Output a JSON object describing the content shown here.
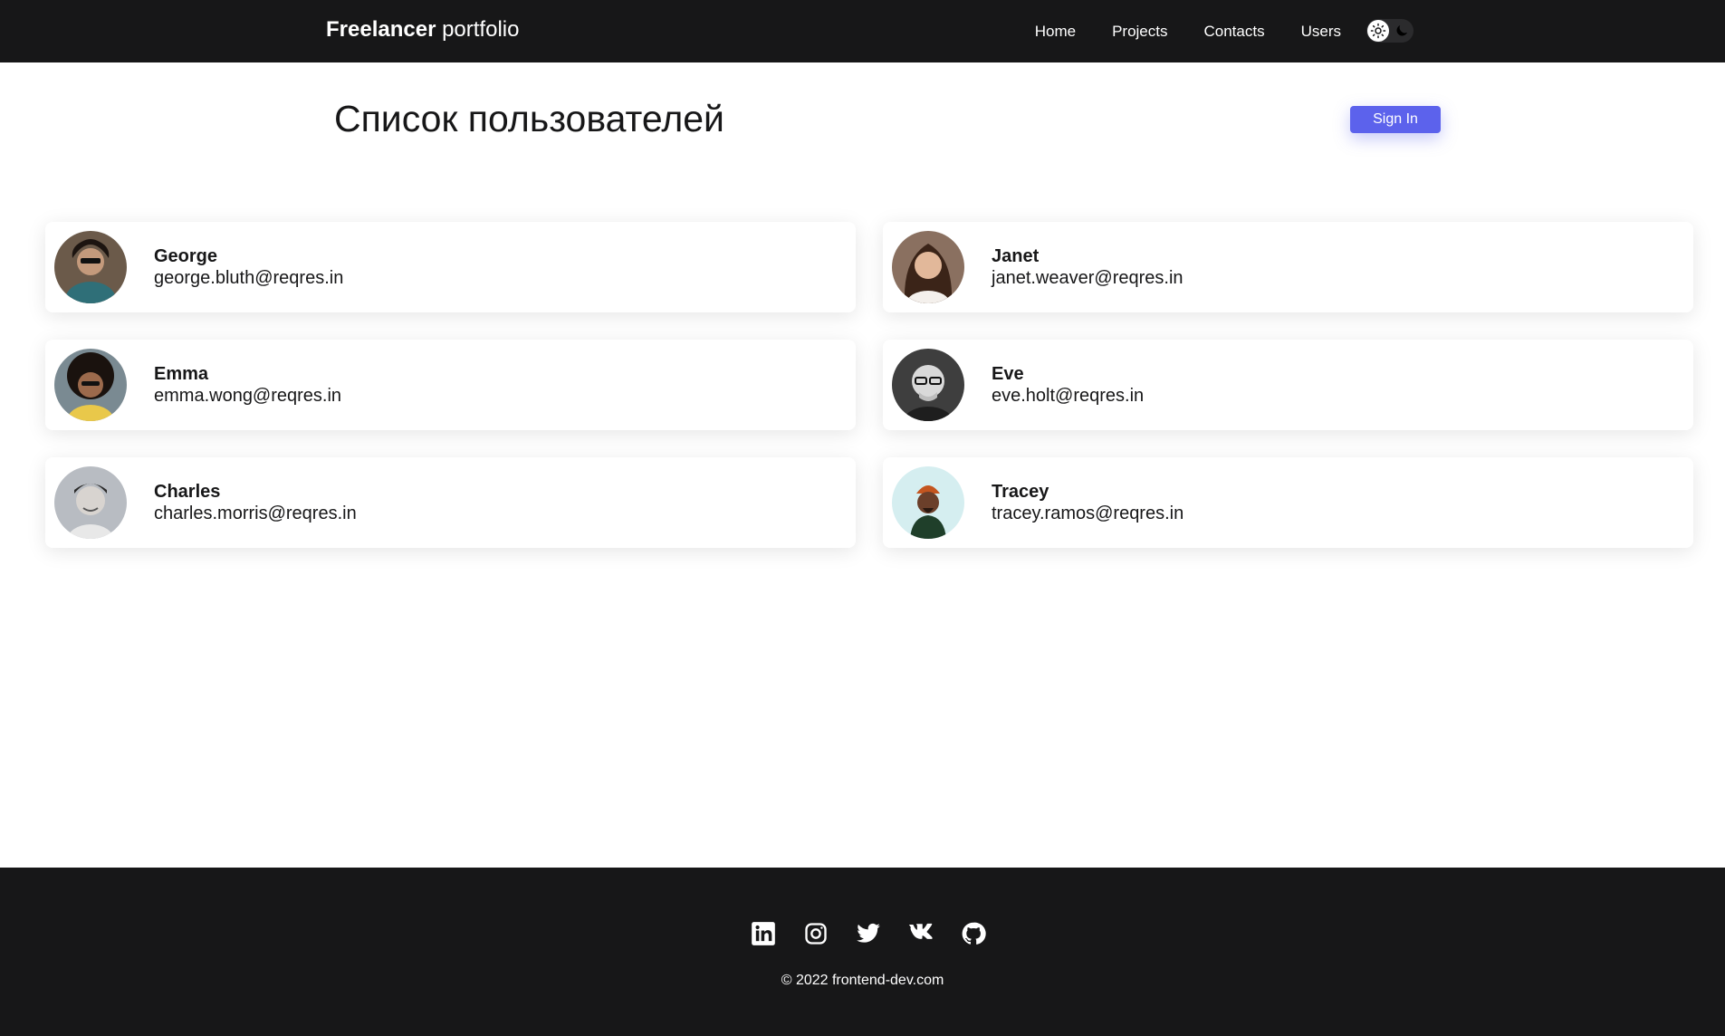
{
  "navbar": {
    "brand_bold": "Freelancer",
    "brand_rest": "portfolio",
    "links": [
      "Home",
      "Projects",
      "Contacts",
      "Users"
    ],
    "theme_icons": [
      "sun-icon",
      "moon-icon"
    ]
  },
  "header": {
    "title": "Список пользователей",
    "signin_label": "Sign In"
  },
  "users": [
    {
      "name": "George",
      "email": "george.bluth@reqres.in",
      "avatar_bg": "#6b5a4a"
    },
    {
      "name": "Janet",
      "email": "janet.weaver@reqres.in",
      "avatar_bg": "#8a7060"
    },
    {
      "name": "Emma",
      "email": "emma.wong@reqres.in",
      "avatar_bg": "#7a8a92"
    },
    {
      "name": "Eve",
      "email": "eve.holt@reqres.in",
      "avatar_bg": "#3e3e3e"
    },
    {
      "name": "Charles",
      "email": "charles.morris@reqres.in",
      "avatar_bg": "#b8bcc2"
    },
    {
      "name": "Tracey",
      "email": "tracey.ramos@reqres.in",
      "avatar_bg": "#d5eef0"
    }
  ],
  "footer": {
    "socials": [
      "linkedin-icon",
      "instagram-icon",
      "twitter-icon",
      "vk-icon",
      "github-icon"
    ],
    "copyright": "© 2022 frontend-dev.com"
  },
  "colors": {
    "dark": "#171718",
    "accent": "#5c62ec",
    "background": "#ffffff"
  }
}
